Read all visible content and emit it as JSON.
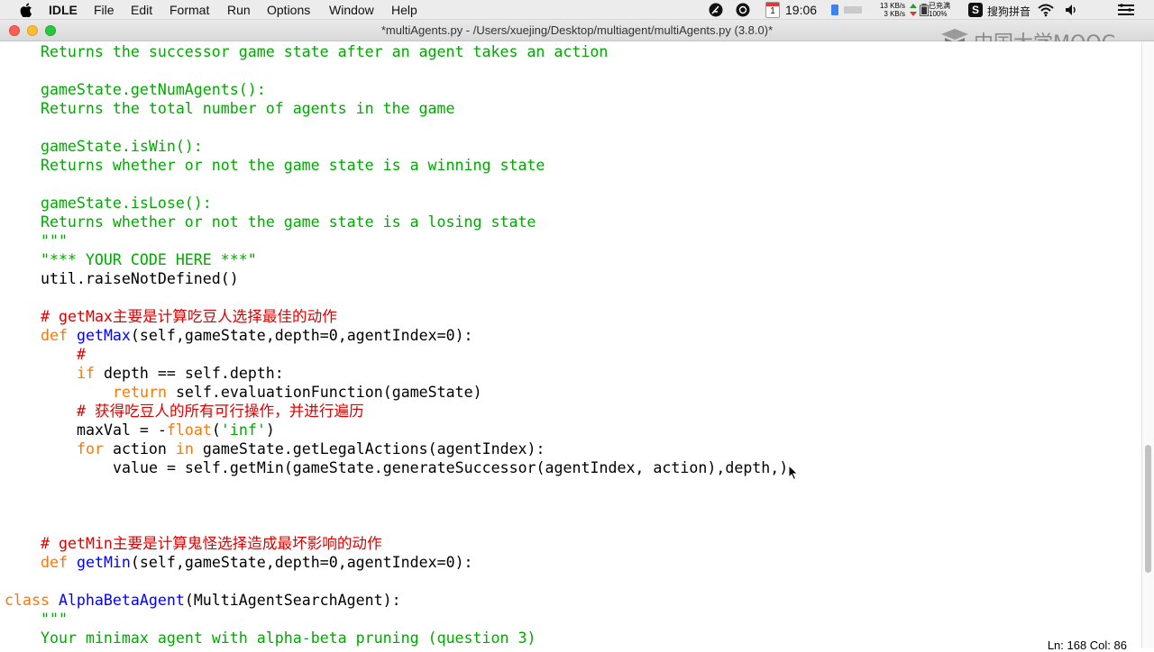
{
  "menubar": {
    "app_name": "IDLE",
    "items": [
      "File",
      "Edit",
      "Format",
      "Run",
      "Options",
      "Window",
      "Help"
    ],
    "calendar_day": "1",
    "time": "19:06",
    "net_up": "13 KB/s",
    "net_down": "3 KB/s",
    "battery_status": "已充满",
    "battery_percent": "100%",
    "input_method": "搜狗拼音"
  },
  "window": {
    "title": "*multiAgents.py - /Users/xuejing/Desktop/multiagent/multiAgents.py (3.8.0)*"
  },
  "watermark": {
    "text": "中国大学MOOC"
  },
  "code": {
    "line1": "    Returns the successor game state after an agent takes an action",
    "line2": "    gameState.getNumAgents():",
    "line3": "    Returns the total number of agents in the game",
    "line4": "    gameState.isWin():",
    "line5": "    Returns whether or not the game state is a winning state",
    "line6": "    gameState.isLose():",
    "line7": "    Returns whether or not the game state is a losing state",
    "line8": "    \"\"\"",
    "line9": "    \"*** YOUR CODE HERE ***\"",
    "line10": "    util.raiseNotDefined()",
    "line11": "# getMax主要是计算吃豆人选择最佳的动作",
    "line12_kw": "def ",
    "line12_fn": "getMax",
    "line12_rest": "(self,gameState,depth=0,agentIndex=0):",
    "line13": "#",
    "line14_kw": "if",
    "line14_rest": " depth == self.depth:",
    "line15_kw": "return",
    "line15_rest": " self.evaluationFunction(gameState)",
    "line16": "# 获得吃豆人的所有可行操作，并进行遍历",
    "line17_a": "maxVal = -",
    "line17_kw": "float",
    "line17_b": "(",
    "line17_s": "'inf'",
    "line17_c": ")",
    "line18_kw1": "for",
    "line18_a": " action ",
    "line18_kw2": "in",
    "line18_b": " gameState.getLegalActions(agentIndex):",
    "line19": "value = self.getMin(gameState.generateSuccessor(agentIndex, action),depth,)",
    "line20": "# getMin主要是计算鬼怪选择造成最坏影响的动作",
    "line21_kw": "def ",
    "line21_fn": "getMin",
    "line21_rest": "(self,gameState,depth=0,agentIndex=0):",
    "line22_kw": "class ",
    "line22_fn": "AlphaBetaAgent",
    "line22_rest": "(MultiAgentSearchAgent):",
    "line23": "\"\"\"",
    "line24": "Your minimax agent with alpha-beta pruning (question 3)"
  },
  "status": {
    "position": "Ln: 168   Col: 86"
  },
  "colors": {
    "string": "#00aa00",
    "keyword": "#ff7700",
    "definition": "#0000ff",
    "comment": "#dd0000"
  }
}
